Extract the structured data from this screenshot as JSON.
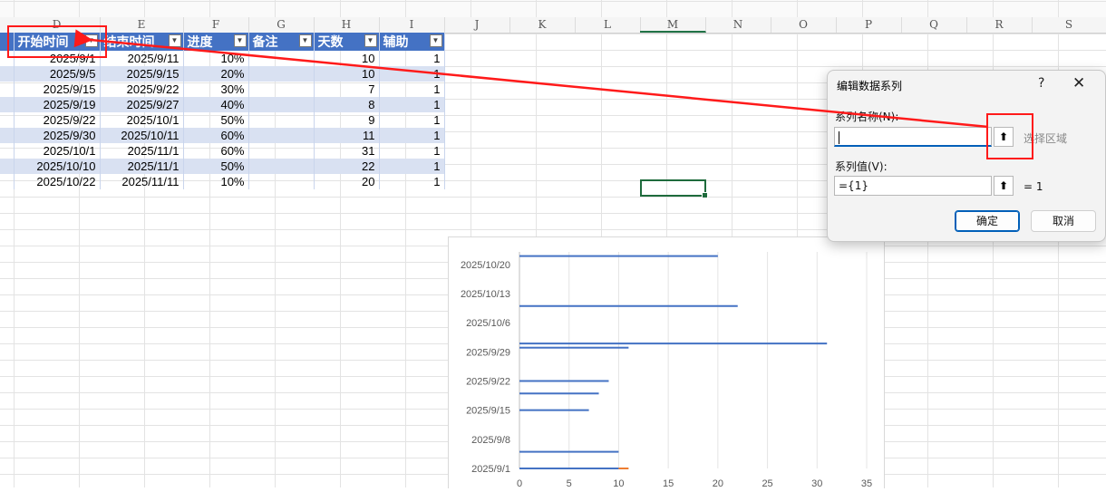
{
  "columns": [
    "D",
    "E",
    "F",
    "G",
    "H",
    "I",
    "J",
    "K",
    "L",
    "M",
    "N",
    "O",
    "P",
    "Q",
    "R",
    "S"
  ],
  "table": {
    "headers": [
      "开始时间",
      "结束时间",
      "进度",
      "备注",
      "天数",
      "辅助"
    ],
    "filter_icon": "filter-dropdown-icon",
    "rows": [
      {
        "start": "2025/9/1",
        "end": "2025/9/11",
        "progress": "10%",
        "note": "",
        "days": "10",
        "aux": "1"
      },
      {
        "start": "2025/9/5",
        "end": "2025/9/15",
        "progress": "20%",
        "note": "",
        "days": "10",
        "aux": "1"
      },
      {
        "start": "2025/9/15",
        "end": "2025/9/22",
        "progress": "30%",
        "note": "",
        "days": "7",
        "aux": "1"
      },
      {
        "start": "2025/9/19",
        "end": "2025/9/27",
        "progress": "40%",
        "note": "",
        "days": "8",
        "aux": "1"
      },
      {
        "start": "2025/9/22",
        "end": "2025/10/1",
        "progress": "50%",
        "note": "",
        "days": "9",
        "aux": "1"
      },
      {
        "start": "2025/9/30",
        "end": "2025/10/11",
        "progress": "60%",
        "note": "",
        "days": "11",
        "aux": "1"
      },
      {
        "start": "2025/10/1",
        "end": "2025/11/1",
        "progress": "60%",
        "note": "",
        "days": "31",
        "aux": "1"
      },
      {
        "start": "2025/10/10",
        "end": "2025/11/1",
        "progress": "50%",
        "note": "",
        "days": "22",
        "aux": "1"
      },
      {
        "start": "2025/10/22",
        "end": "2025/11/11",
        "progress": "10%",
        "note": "",
        "days": "20",
        "aux": "1"
      }
    ]
  },
  "dialog": {
    "title": "编辑数据系列",
    "help": "?",
    "close": "✕",
    "name_label": "系列名称(N):",
    "name_value": "",
    "name_hint": "选择区域",
    "values_label": "系列值(V):",
    "values_value": "={1}",
    "values_result": "= 1",
    "collapse_glyph": "⬆",
    "ok": "确定",
    "cancel": "取消"
  },
  "chart_data": {
    "type": "bar",
    "orientation": "horizontal",
    "title": "",
    "categories": [
      "2025/9/1",
      "2025/9/5",
      "2025/9/15",
      "2025/9/19",
      "2025/9/22",
      "2025/9/30",
      "2025/10/1",
      "2025/10/10",
      "2025/10/22"
    ],
    "y_tick_labels": [
      "2025/9/1",
      "2025/9/8",
      "2025/9/15",
      "2025/9/22",
      "2025/9/29",
      "2025/10/6",
      "2025/10/13",
      "2025/10/20"
    ],
    "y_range": [
      "2025/9/1",
      "2025/10/23"
    ],
    "x_tick_labels": [
      "0",
      "5",
      "10",
      "15",
      "20",
      "25",
      "30",
      "35"
    ],
    "xlim": [
      0,
      35
    ],
    "grid": "vertical",
    "series": [
      {
        "values": [
          10,
          10,
          7,
          8,
          9,
          11,
          31,
          22,
          20
        ],
        "color": "#4472c4"
      },
      {
        "values": [
          1
        ],
        "color": "#ed7d31"
      }
    ]
  }
}
